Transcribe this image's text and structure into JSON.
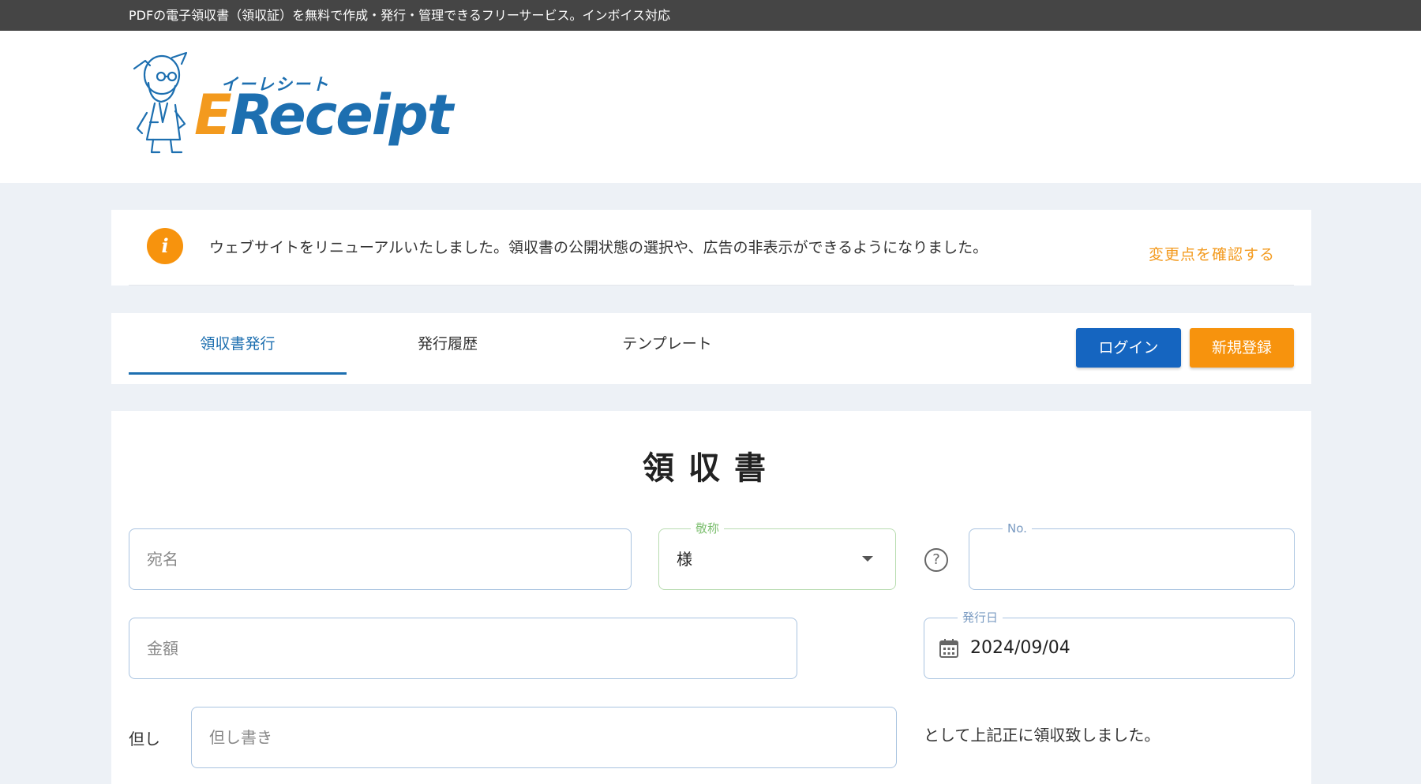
{
  "topbar": {
    "text": "PDFの電子領収書（領収証）を無料で作成・発行・管理できるフリーサービス。インボイス対応"
  },
  "logo": {
    "kana": "イーレシート",
    "word_first": "E",
    "word_rest": "Receipt"
  },
  "notice": {
    "icon": "info-icon",
    "text": "ウェブサイトをリニューアルいたしました。領収書の公開状態の選択や、広告の非表示ができるようになりました。",
    "link": "変更点を確認する"
  },
  "tabs": [
    {
      "label": "領収書発行",
      "active": true
    },
    {
      "label": "発行履歴",
      "active": false
    },
    {
      "label": "テンプレート",
      "active": false
    }
  ],
  "buttons": {
    "login": "ログイン",
    "register": "新規登録"
  },
  "form": {
    "title": "領収書",
    "recipient": {
      "placeholder": "宛名"
    },
    "honorific": {
      "legend": "敬称",
      "value": "様"
    },
    "number": {
      "legend": "No.",
      "value": ""
    },
    "amount": {
      "placeholder": "金額"
    },
    "issue_date": {
      "legend": "発行日",
      "value": "2024/09/04"
    },
    "note": {
      "label": "但し",
      "placeholder": "但し書き"
    },
    "received_text": "として上記正に領収致しました。"
  },
  "colors": {
    "primary": "#1d6fb0",
    "accent": "#f39a1e",
    "topbar": "#454545",
    "background": "#edf1f6"
  }
}
